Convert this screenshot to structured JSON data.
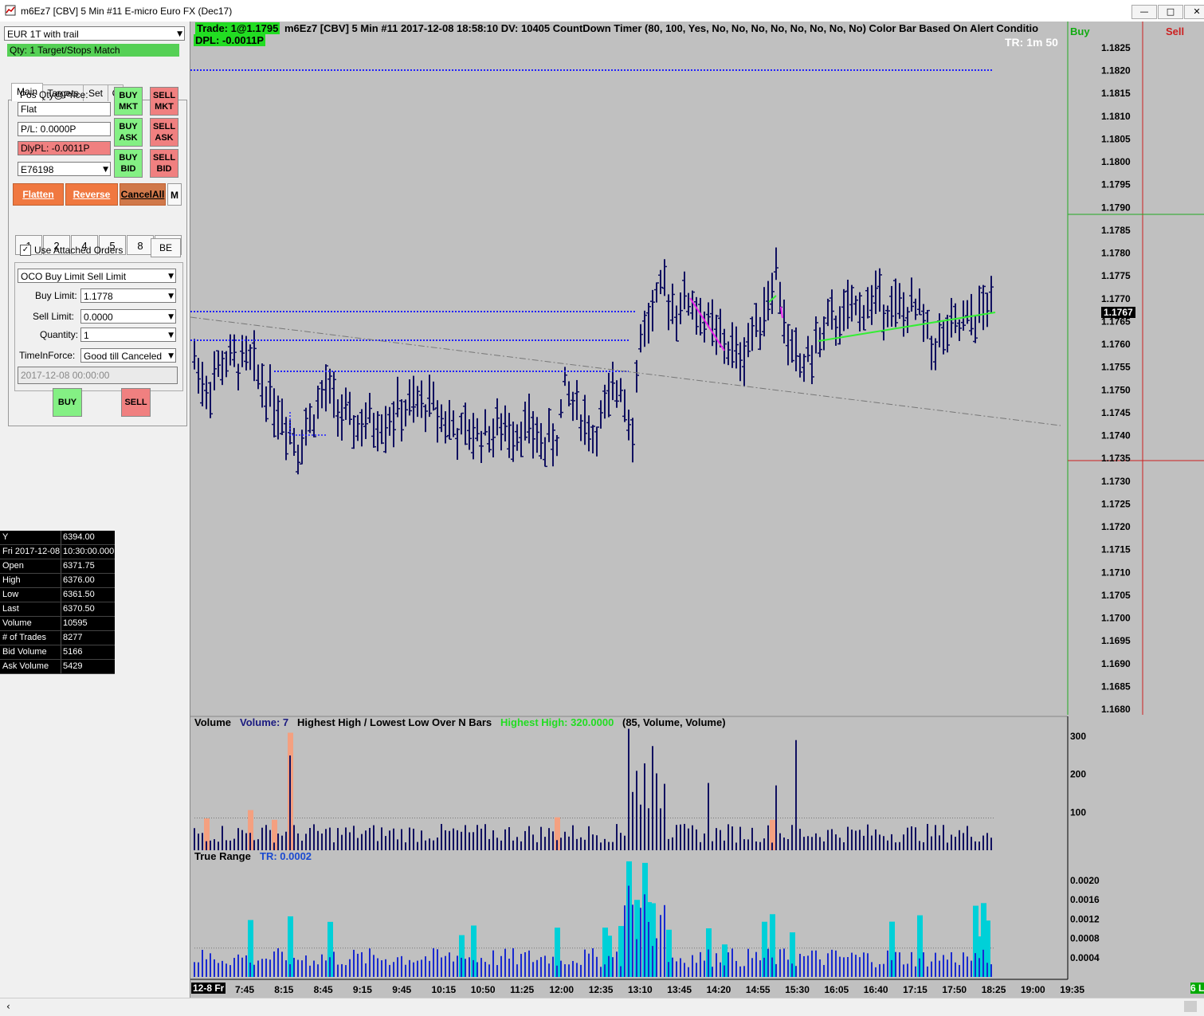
{
  "window": {
    "title": "m6Ez7 [CBV]  5 Min   #11  E-micro Euro FX (Dec17)",
    "controls": [
      "minimize",
      "maximize",
      "close"
    ]
  },
  "panel": {
    "strategy": "EUR 1T with trail",
    "qty_status": "Qty: 1 Target/Stops Match",
    "tabs": [
      "Main",
      "Targets",
      "Set",
      "C"
    ],
    "pos_label": "Pos Qty@Price:",
    "pos_value": "Flat",
    "pl": "P/L: 0.0000P",
    "dly_pl": "DlyPL: -0.0011P",
    "account": "E76198",
    "buy_mkt": "BUY MKT",
    "sell_mkt": "SELL MKT",
    "buy_ask": "BUY ASK",
    "sell_ask": "SELL ASK",
    "buy_bid": "BUY BID",
    "sell_bid": "SELL BID",
    "flatten": "Flatten",
    "reverse": "Reverse",
    "cancel_all": "CancelAll",
    "m": "M",
    "qty_buttons": [
      "1",
      "2",
      "4",
      "5",
      "8",
      "0"
    ],
    "use_attached": "Use Attached Orders",
    "be": "BE",
    "order_type": "OCO Buy Limit Sell Limit",
    "buy_limit_label": "Buy Limit:",
    "buy_limit": "1.1778",
    "sell_limit_label": "Sell Limit:",
    "sell_limit": "0.0000",
    "quantity_label": "Quantity:",
    "quantity": "1",
    "tif_label": "TimeInForce:",
    "tif": "Good till Canceled",
    "datetime": "2017-12-08  00:00:00",
    "buy": "BUY",
    "sell": "SELL"
  },
  "data_window": [
    {
      "k": "Y",
      "v": "6394.00"
    },
    {
      "k": "Fri 2017-12-08",
      "v": "10:30:00.000"
    },
    {
      "k": "Open",
      "v": "6371.75"
    },
    {
      "k": "High",
      "v": "6376.00"
    },
    {
      "k": "Low",
      "v": "6361.50"
    },
    {
      "k": "Last",
      "v": "6370.50"
    },
    {
      "k": "Volume",
      "v": "10595"
    },
    {
      "k": "# of Trades",
      "v": "8277"
    },
    {
      "k": "Bid Volume",
      "v": "5166"
    },
    {
      "k": "Ask Volume",
      "v": "5429"
    }
  ],
  "chart": {
    "trade": "Trade: 1@1.1795",
    "header": "m6Ez7 [CBV]  5 Min   #11 2017-12-08 18:58:10 DV: 10405  CountDown Timer   (80, 100, Yes, No, No, No, No, No, No, No, No)  Color Bar Based On Alert Conditio",
    "dpl": "DPL: -0.0011P",
    "tr_timer": "TR: 1m 50",
    "dom_buy": "Buy",
    "dom_sell": "Sell",
    "last_price": "1.1767",
    "price_ticks": [
      "1.1825",
      "1.1820",
      "1.1815",
      "1.1810",
      "1.1805",
      "1.1800",
      "1.1795",
      "1.1790",
      "1.1785",
      "1.1780",
      "1.1775",
      "1.1770",
      "1.1765",
      "1.1760",
      "1.1755",
      "1.1750",
      "1.1745",
      "1.1740",
      "1.1735",
      "1.1730",
      "1.1725",
      "1.1720",
      "1.1715",
      "1.1710",
      "1.1705",
      "1.1700",
      "1.1695",
      "1.1690",
      "1.1685",
      "1.1680"
    ],
    "volume_title": "Volume",
    "volume_value": "Volume: 7",
    "hh_title": "Highest High / Lowest Low Over N Bars",
    "hh_value": "Highest High: 320.0000",
    "hh_params": "(85, Volume, Volume)",
    "volume_ticks": [
      "300",
      "200",
      "100"
    ],
    "tr_title": "True Range",
    "tr_value": "TR: 0.0002",
    "tr_ticks": [
      "0.0020",
      "0.0016",
      "0.0012",
      "0.0008",
      "0.0004"
    ],
    "date_label": "12-8 Fr",
    "time_ticks": [
      "7:45",
      "8:15",
      "8:45",
      "9:15",
      "9:45",
      "10:15",
      "10:50",
      "11:25",
      "12:00",
      "12:35",
      "13:10",
      "13:45",
      "14:20",
      "14:55",
      "15:30",
      "16:05",
      "16:40",
      "17:15",
      "17:50",
      "18:25",
      "19:00",
      "19:35"
    ],
    "corner": "6 L"
  },
  "colors": {
    "bar": "#101060",
    "order_line": "#2020ff",
    "volume_hi": "#f4a080",
    "tr_hi": "#00d0d8",
    "buy_green": "#40e040",
    "sell_red": "#c00000"
  }
}
